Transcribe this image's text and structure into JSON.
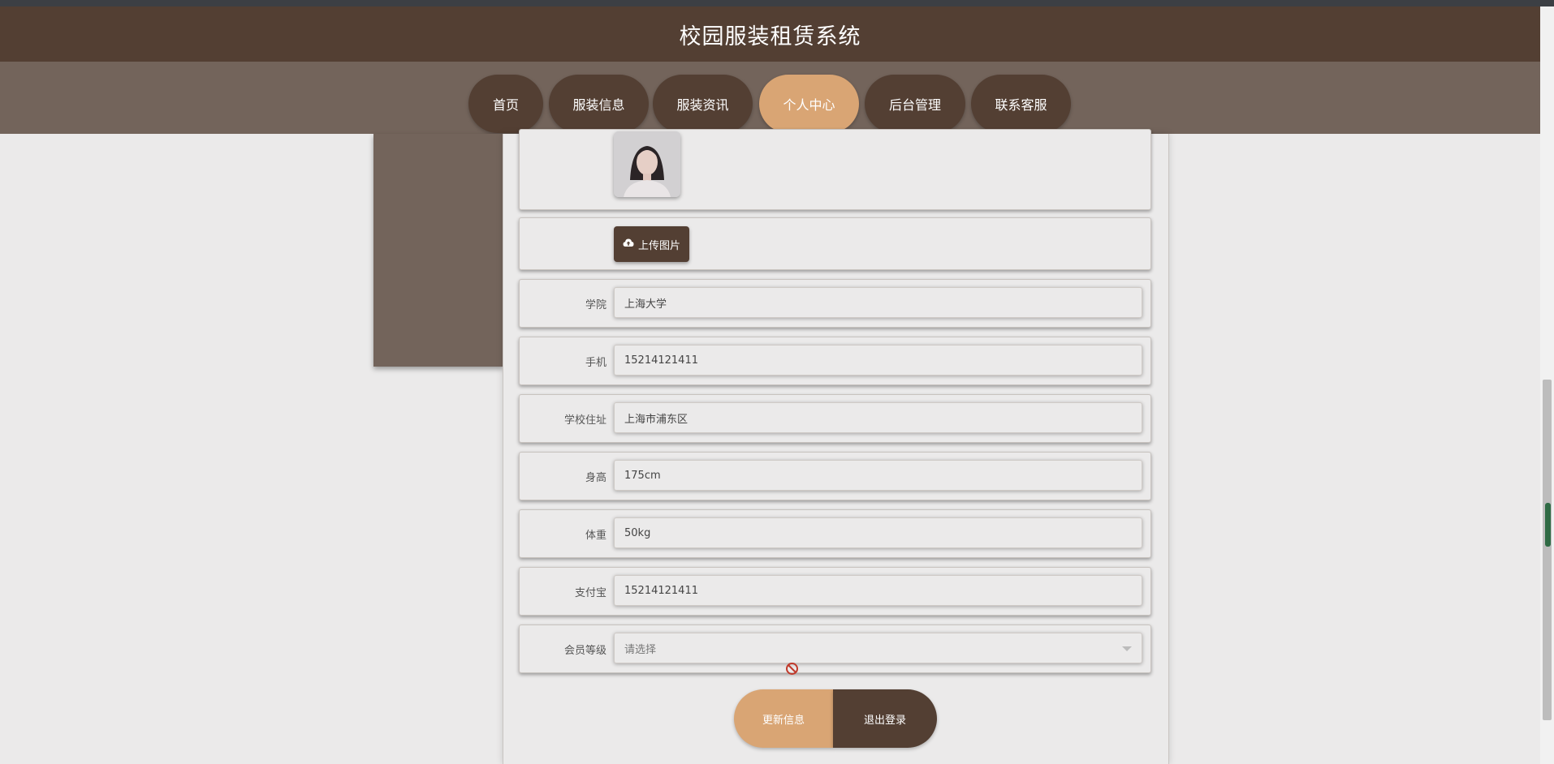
{
  "header": {
    "title": "校园服装租赁系统"
  },
  "nav": {
    "items": [
      {
        "label": "首页",
        "active": false
      },
      {
        "label": "服装信息",
        "active": false
      },
      {
        "label": "服装资讯",
        "active": false
      },
      {
        "label": "个人中心",
        "active": true
      },
      {
        "label": "后台管理",
        "active": false
      },
      {
        "label": "联系客服",
        "active": false
      }
    ]
  },
  "form": {
    "upload_label": "上传图片",
    "fields": {
      "college": {
        "label": "学院",
        "value": "上海大学"
      },
      "phone": {
        "label": "手机",
        "value": "15214121411"
      },
      "school_address": {
        "label": "学校住址",
        "value": "上海市浦东区"
      },
      "height": {
        "label": "身高",
        "value": "175cm"
      },
      "weight": {
        "label": "体重",
        "value": "50kg"
      },
      "alipay": {
        "label": "支付宝",
        "value": "15214121411"
      },
      "member_level": {
        "label": "会员等级",
        "placeholder": "请选择"
      }
    },
    "update_label": "更新信息",
    "logout_label": "退出登录"
  },
  "colors": {
    "primary_dark": "#533f33",
    "nav_bg": "#73645b",
    "accent": "#d9a574",
    "page_bg": "#ebeaea"
  },
  "icons": [
    "cloud-upload-icon",
    "chevron-down-icon",
    "not-allowed-cursor-icon"
  ]
}
